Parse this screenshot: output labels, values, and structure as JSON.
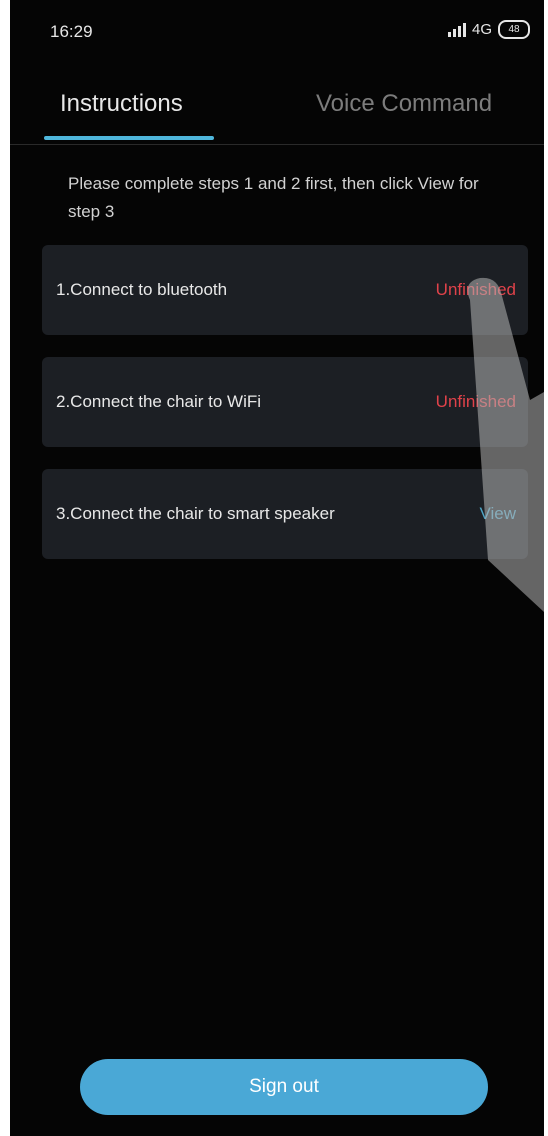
{
  "status_bar": {
    "time": "16:29",
    "network": "4G",
    "battery": "48"
  },
  "tabs": [
    {
      "label": "Instructions",
      "active": true
    },
    {
      "label": "Voice Command",
      "active": false
    }
  ],
  "hint": "Please complete steps 1 and 2 first, then click View for step 3",
  "steps": [
    {
      "label": "1.Connect to bluetooth",
      "status": "Unfinished"
    },
    {
      "label": "2.Connect the chair to WiFi",
      "status": "Unfinished"
    },
    {
      "label": "3.Connect the chair to smart speaker",
      "status": "View"
    }
  ],
  "sign_out_label": "Sign out",
  "colors": {
    "accent": "#4fb7dc",
    "unfinished": "#e0424a",
    "view": "#4fa4c4",
    "card": "#1c1f24",
    "background": "#050505"
  }
}
